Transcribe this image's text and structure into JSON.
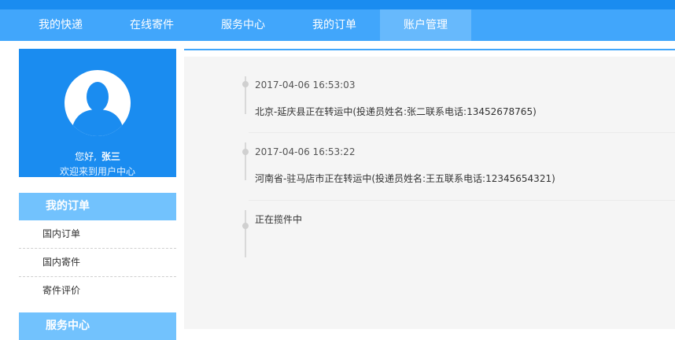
{
  "nav": {
    "items": [
      {
        "label": "我的快递"
      },
      {
        "label": "在线寄件"
      },
      {
        "label": "服务中心"
      },
      {
        "label": "我的订单"
      },
      {
        "label": "账户管理"
      }
    ]
  },
  "profile": {
    "greeting": "您好,",
    "username": "张三",
    "welcome": "欢迎来到用户中心"
  },
  "sidebar": {
    "orders": {
      "title": "我的订单",
      "items": [
        {
          "label": "国内订单"
        },
        {
          "label": "国内寄件"
        },
        {
          "label": "寄件评价"
        }
      ]
    },
    "service": {
      "title": "服务中心"
    }
  },
  "timeline": [
    {
      "time": "2017-04-06 16:53:03",
      "text": "北京-延庆县正在转运中(投递员姓名:张二联系电话:13452678765)"
    },
    {
      "time": "2017-04-06 16:53:22",
      "text": "河南省-驻马店市正在转运中(投递员姓名:王五联系电话:12345654321)"
    },
    {
      "time": "",
      "text": "正在揽件中"
    }
  ],
  "colors": {
    "primary": "#1a8cf0",
    "nav": "#41a6fb",
    "nav_active": "#67b9fc",
    "panel_head": "#72c2fd"
  }
}
